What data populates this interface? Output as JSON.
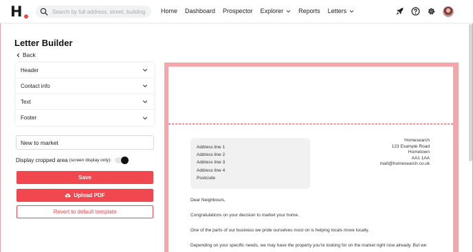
{
  "topbar": {
    "logo_text": "H",
    "search_placeholder": "Search by full address, street, building",
    "nav": [
      {
        "label": "Home",
        "dropdown": false
      },
      {
        "label": "Dashboard",
        "dropdown": false
      },
      {
        "label": "Prospector",
        "dropdown": false
      },
      {
        "label": "Explorer",
        "dropdown": true
      },
      {
        "label": "Reports",
        "dropdown": false
      },
      {
        "label": "Letters",
        "dropdown": true
      }
    ],
    "icons": [
      "rocket-icon",
      "help-icon",
      "gear-icon"
    ]
  },
  "builder": {
    "title": "Letter Builder",
    "back_label": "Back",
    "sections": [
      "Header",
      "Contact info",
      "Text",
      "Footer"
    ],
    "template_name": "New to market",
    "crop_label": "Display cropped area",
    "crop_note": "(screen display only):",
    "crop_enabled": true,
    "save_label": "Save",
    "upload_label": "Upload PDF",
    "revert_label": "Revert to default template"
  },
  "letter": {
    "recipient": [
      "Address line 1",
      "Address line 2",
      "Address line 3",
      "Address line 4",
      "Postcode"
    ],
    "sender": [
      "Homesearch",
      "123 Example Road",
      "Hometown",
      "AA1 1AA",
      "matt@homesearch.co.uk"
    ],
    "paragraphs": [
      "Dear Neighbours,",
      "Congratulations on your decision to market your home.",
      "One of the parts of our business we pride ourselves most on is helping locals move locally.",
      "Depending on your specific needs, we may have the property you're looking for on the market right now already. But we"
    ]
  },
  "colors": {
    "accent": "#f0484e",
    "preview_border": "#f4a7aa"
  }
}
